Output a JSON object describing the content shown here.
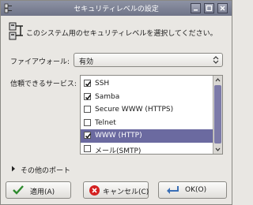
{
  "window": {
    "title": "セキュリティレベルの設定"
  },
  "header": {
    "text": "このシステム用のセキュリティレベルを選択してください。"
  },
  "firewall": {
    "label": "ファイアウォール:",
    "value": "有効"
  },
  "services": {
    "label": "信頼できるサービス:",
    "items": [
      {
        "label": "SSH",
        "checked": true
      },
      {
        "label": "Samba",
        "checked": true
      },
      {
        "label": "Secure WWW (HTTPS)",
        "checked": false
      },
      {
        "label": "Telnet",
        "checked": false
      },
      {
        "label": "WWW (HTTP)",
        "checked": true,
        "selected": true
      },
      {
        "label": "メール(SMTP)",
        "checked": false
      }
    ]
  },
  "other_ports": {
    "label": "その他のポート"
  },
  "buttons": {
    "apply": "適用(A)",
    "cancel": "キャンセル(C)",
    "ok": "OK(O)"
  },
  "colors": {
    "titlebar": "#7f8497",
    "selection": "#6b6aa0",
    "background": "#e9e7e3"
  }
}
